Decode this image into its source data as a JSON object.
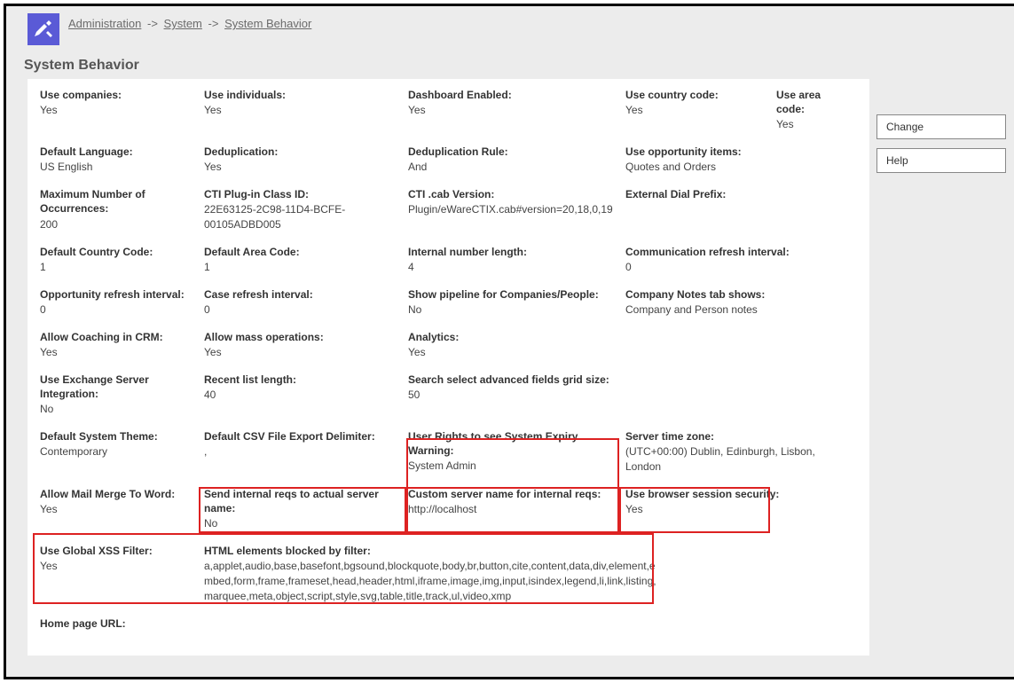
{
  "breadcrumb": {
    "administration": "Administration",
    "system": "System",
    "system_behavior": "System Behavior"
  },
  "page_title": "System Behavior",
  "sidebar": {
    "change": "Change",
    "help": "Help"
  },
  "rows": {
    "r1": {
      "c1l": "Use companies:",
      "c1v": "Yes",
      "c2l": "Use individuals:",
      "c2v": "Yes",
      "c3l": "Dashboard Enabled:",
      "c3v": "Yes",
      "c4l": "Use country code:",
      "c4v": "Yes",
      "c5l": "Use area code:",
      "c5v": "Yes"
    },
    "r2": {
      "c1l": "Default Language:",
      "c1v": "US English",
      "c2l": "Deduplication:",
      "c2v": "Yes",
      "c3l": "Deduplication Rule:",
      "c3v": "And",
      "c4l": "Use opportunity items:",
      "c4v": "Quotes and Orders"
    },
    "r3": {
      "c1l": "Maximum Number of Occurrences:",
      "c1v": "200",
      "c2l": "CTI Plug-in Class ID:",
      "c2v": "22E63125-2C98-11D4-BCFE-00105ADBD005",
      "c3l": "CTI .cab Version:",
      "c3v": "Plugin/eWareCTIX.cab#version=20,18,0,19",
      "c4l": "External Dial Prefix:",
      "c4v": ""
    },
    "r4": {
      "c1l": "Default Country Code:",
      "c1v": "1",
      "c2l": "Default Area Code:",
      "c2v": "1",
      "c3l": "Internal number length:",
      "c3v": "4",
      "c4l": "Communication refresh interval:",
      "c4v": "0"
    },
    "r5": {
      "c1l": "Opportunity refresh interval:",
      "c1v": "0",
      "c2l": "Case refresh interval:",
      "c2v": "0",
      "c3l": "Show pipeline for Companies/People:",
      "c3v": "No",
      "c4l": "Company Notes tab shows:",
      "c4v": "Company and Person notes"
    },
    "r6": {
      "c1l": "Allow Coaching in CRM:",
      "c1v": "Yes",
      "c2l": "Allow mass operations:",
      "c2v": "Yes",
      "c3l": "Analytics:",
      "c3v": "Yes"
    },
    "r7": {
      "c1l": "Use Exchange Server Integration:",
      "c1v": "No",
      "c2l": "Recent list length:",
      "c2v": "40",
      "c3l": "Search select advanced fields grid size:",
      "c3v": "50"
    },
    "r8": {
      "c1l": "Default System Theme:",
      "c1v": "Contemporary",
      "c2l": "Default CSV File Export Delimiter:",
      "c2v": ",",
      "c3l": "User Rights to see System Expiry Warning:",
      "c3v": "System Admin",
      "c4l": "Server time zone:",
      "c4v": "(UTC+00:00) Dublin, Edinburgh, Lisbon, London"
    },
    "r9": {
      "c1l": "Allow Mail Merge To Word:",
      "c1v": "Yes",
      "c2l": "Send internal reqs to actual server name:",
      "c2v": "No",
      "c3l": "Custom server name for internal reqs:",
      "c3v": "http://localhost",
      "c4l": "Use browser session security:",
      "c4v": "Yes"
    },
    "r10": {
      "c1l": "Use Global XSS Filter:",
      "c1v": "Yes",
      "c2l": "HTML elements blocked by filter:",
      "c2v": "a,applet,audio,base,basefont,bgsound,blockquote,body,br,button,cite,content,data,div,element,embed,form,frame,frameset,head,header,html,iframe,image,img,input,isindex,legend,li,link,listing,marquee,meta,object,script,style,svg,table,title,track,ul,video,xmp"
    },
    "r11": {
      "c1l": "Home page URL:"
    }
  }
}
